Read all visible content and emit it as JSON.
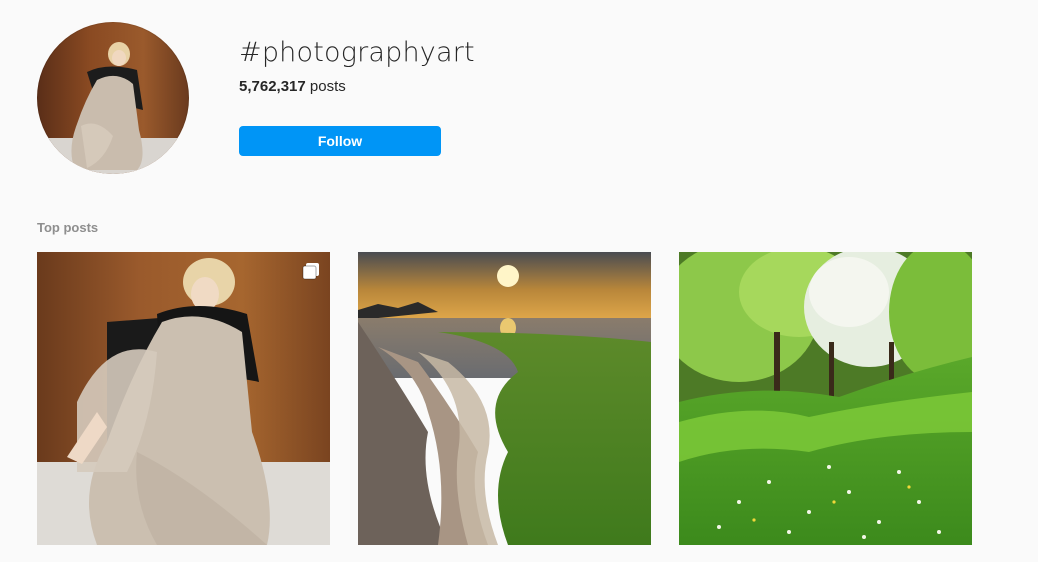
{
  "header": {
    "hashtag": "#photographyart",
    "post_count": "5,762,317",
    "post_count_suffix": " posts",
    "follow_label": "Follow"
  },
  "top_posts": {
    "label": "Top posts",
    "items": [
      {
        "subject": "portrait-photo",
        "has_multiple": true,
        "icon": "carousel-icon"
      },
      {
        "subject": "sunset-coast-photo",
        "has_multiple": false
      },
      {
        "subject": "green-meadow-trees-photo",
        "has_multiple": false
      }
    ]
  },
  "colors": {
    "accent": "#0095f6",
    "background": "#fafafa",
    "muted_text": "#8e8e8e"
  }
}
